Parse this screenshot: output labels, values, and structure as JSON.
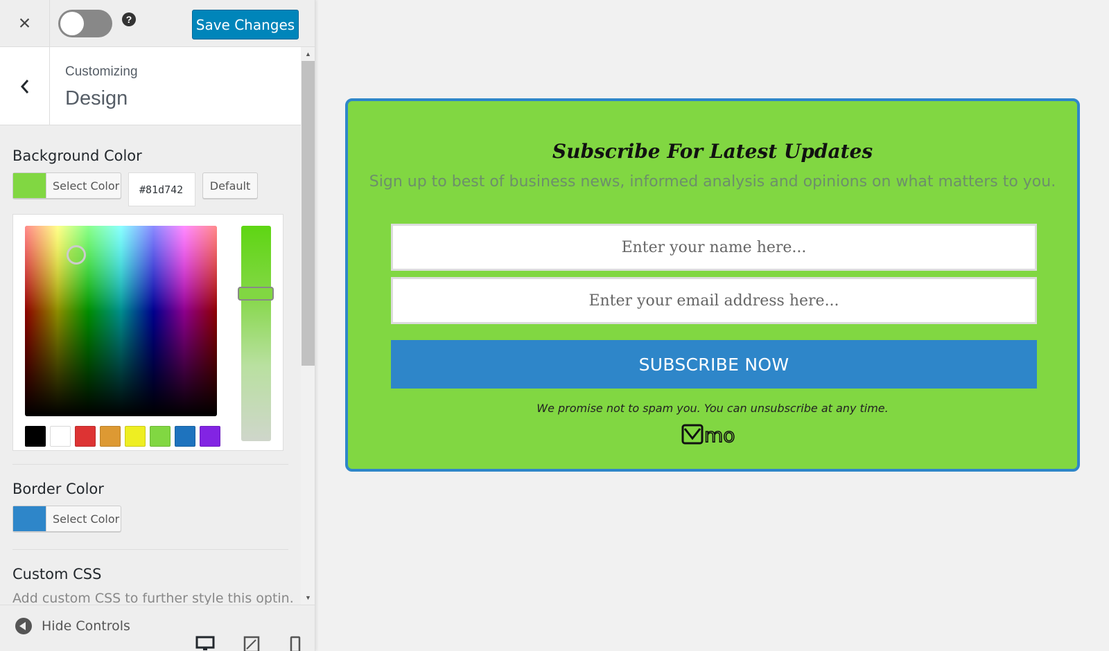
{
  "topbar": {
    "close_glyph": "×",
    "help_glyph": "?",
    "save_label": "Save Changes"
  },
  "panel_header": {
    "back_glyph": "‹",
    "customizing_label": "Customizing",
    "section_title": "Design"
  },
  "background_color": {
    "label": "Background Color",
    "select_label": "Select Color",
    "swatch_color": "#81d742",
    "hex_value": "#81d742",
    "default_label": "Default"
  },
  "color_picker": {
    "palette": [
      "#000000",
      "#ffffff",
      "#dd3333",
      "#dd9933",
      "#eeee22",
      "#81d742",
      "#1e73be",
      "#8224e3"
    ]
  },
  "border_color": {
    "label": "Border Color",
    "select_label": "Select Color",
    "swatch_color": "#2e86c9"
  },
  "custom_css": {
    "label": "Custom CSS",
    "hint": "Add custom CSS to further style this optin."
  },
  "footer": {
    "hide_controls_label": "Hide Controls",
    "devices": [
      "desktop-icon",
      "tablet-icon",
      "mobile-icon"
    ]
  },
  "preview": {
    "title": "Subscribe For Latest Updates",
    "description": "Sign up to best of business news, informed analysis and opinions on what matters to you.",
    "name_placeholder": "Enter your name here...",
    "email_placeholder": "Enter your email address here...",
    "button_label": "SUBSCRIBE NOW",
    "promise": "We promise not to spam you. You can unsubscribe at any time.",
    "logo_text": "mo",
    "background": "#81d742",
    "border": "#2e86c9"
  }
}
